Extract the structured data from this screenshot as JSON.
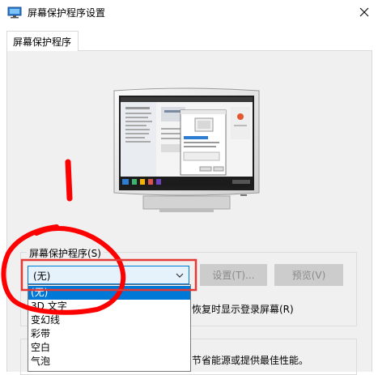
{
  "window": {
    "title": "屏幕保护程序设置"
  },
  "tab": {
    "label": "屏幕保护程序"
  },
  "screensaver": {
    "group_label": "屏幕保护程序(S)",
    "selected": "(无)",
    "settings_button": "设置(T)...",
    "preview_button": "预览(V)",
    "resume_label": "恢复时显示登录屏幕(R)",
    "options": [
      "(无)",
      "3D 文字",
      "变幻线",
      "彩带",
      "空白",
      "气泡"
    ]
  },
  "power": {
    "text": "节省能源或提供最佳性能。"
  },
  "colors": {
    "accent": "#0078d7",
    "annotation": "#ff0000",
    "panel": "#f0f0f0"
  },
  "icons": [
    "monitor-icon",
    "close-icon",
    "chevron-down-icon"
  ]
}
